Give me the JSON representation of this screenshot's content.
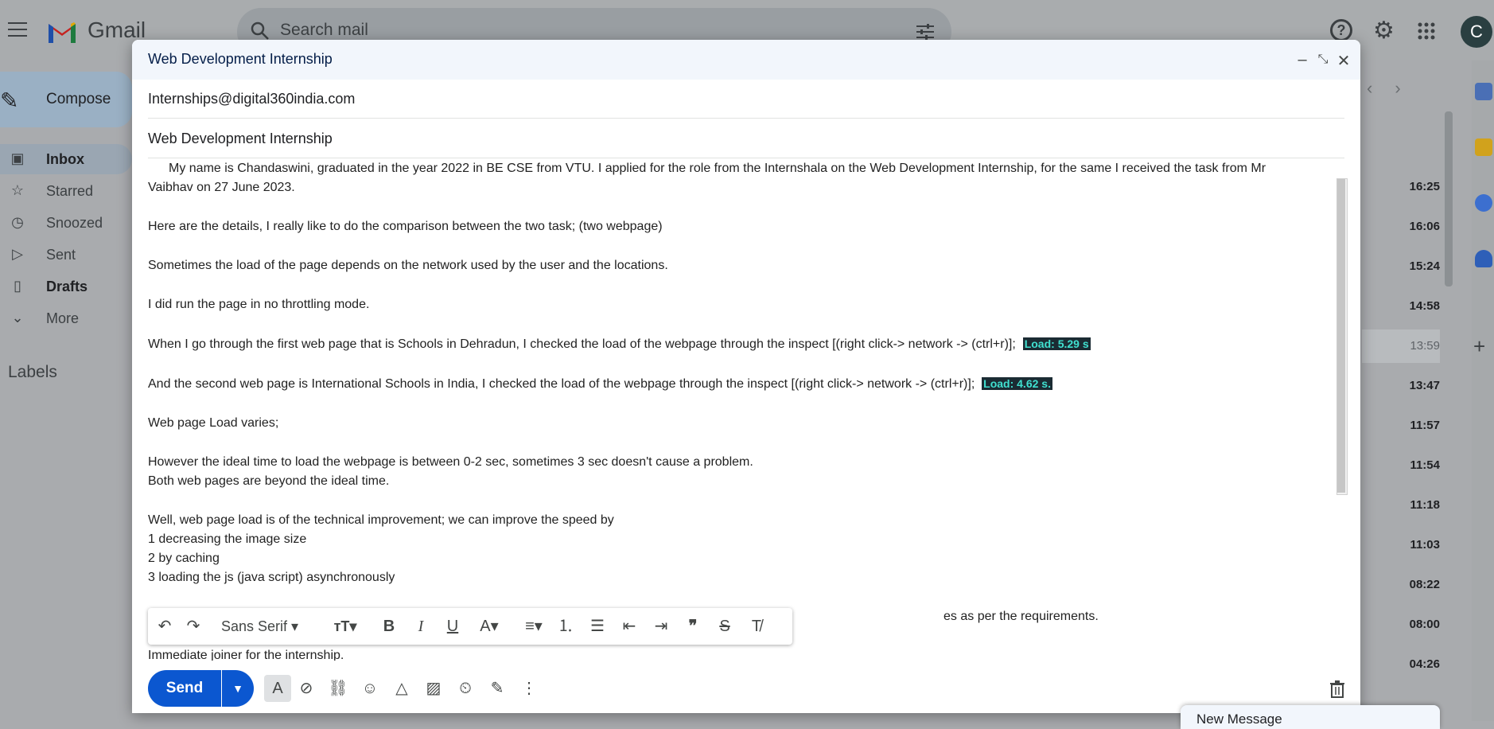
{
  "app": {
    "brand": "Gmail",
    "avatar_letter": "C"
  },
  "search": {
    "placeholder": "Search mail"
  },
  "sidebar": {
    "compose_label": "Compose",
    "items": [
      {
        "label": "Inbox",
        "icon": "inbox-icon"
      },
      {
        "label": "Starred",
        "icon": "star-icon"
      },
      {
        "label": "Snoozed",
        "icon": "clock-icon"
      },
      {
        "label": "Sent",
        "icon": "send-icon"
      },
      {
        "label": "Drafts",
        "icon": "draft-icon"
      },
      {
        "label": "More",
        "icon": "chevron-down-icon"
      }
    ],
    "labels_heading": "Labels"
  },
  "mail_list": {
    "times": [
      "16:25",
      "16:06",
      "15:24",
      "14:58",
      "13:59",
      "13:47",
      "11:57",
      "11:54",
      "11:18",
      "11:03",
      "08:22",
      "08:00",
      "04:26"
    ]
  },
  "compose": {
    "window_title": "Web Development Internship",
    "to": "Internships@digital360india.com",
    "subject": "Web Development Internship",
    "body": {
      "p1": "My name is Chandaswini, graduated in the year 2022 in BE CSE from VTU. I applied for the role from the Internshala on the Web Development Internship, for the same I received the task from Mr",
      "p1b": "Vaibhav on 27 June 2023.",
      "p2": "Here are the details, I really like to do the comparison between the two task; (two webpage)",
      "p3": "Sometimes the load of the page depends on the network used by the user and the locations.",
      "p4": "I did run the page in no throttling mode.",
      "p5": "When I go through the first web page that is Schools in Dehradun, I checked the load of the webpage through the inspect [(right click-> network -> (ctrl+r)];",
      "p5_load": "Load: 5.29 s",
      "p6": "And the second web page is International Schools in India, I checked the load of the webpage through the inspect [(right click-> network -> (ctrl+r)];",
      "p6_load": "Load: 4.62 s.",
      "p7": "Web page Load varies;",
      "p8a": "However the ideal time to load the webpage is between 0-2 sec, sometimes 3 sec doesn't cause a problem.",
      "p8b": "Both web pages are beyond the ideal time.",
      "p9a": "Well, web page load is of the technical improvement; we can improve the speed by",
      "p9b": "1 decreasing the image size",
      "p9c": "2 by caching",
      "p9d": "3 loading the js (java script) asynchronously",
      "p10_tail": "es as per the requirements.",
      "p11": "Immediate joiner for the internship."
    },
    "format_bar": {
      "font_name": "Sans Serif"
    },
    "send_label": "Send",
    "new_message_label": "New Message"
  },
  "colors": {
    "send_blue": "#0b57d0",
    "highlight_bg": "#1b2b33",
    "highlight_text": "#40e0d0",
    "header_bg": "#f2f6fc"
  }
}
